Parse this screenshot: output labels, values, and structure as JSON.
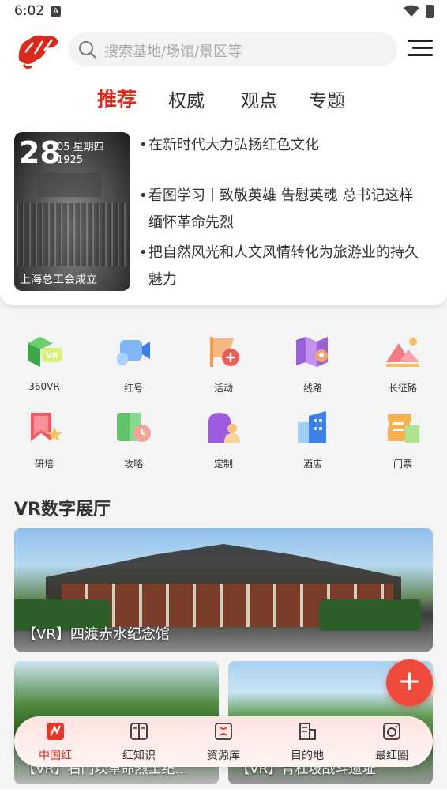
{
  "status_bar": {
    "time": "6:02",
    "notif": "A"
  },
  "header": {
    "search_placeholder": "搜索基地/场馆/景区等"
  },
  "tabs": [
    {
      "label": "推荐",
      "active": true
    },
    {
      "label": "权威",
      "active": false
    },
    {
      "label": "观点",
      "active": false
    },
    {
      "label": "专题",
      "active": false
    }
  ],
  "today_card": {
    "day": "28",
    "month_weekday": "05 星期四",
    "year": "1925",
    "caption": "上海总工会成立"
  },
  "news": [
    {
      "line1": "在新时代大力弘扬红色文化",
      "line2": ""
    },
    {
      "line1": "看图学习丨致敬英雄 告慰英魂 总书记这样",
      "line2": "缅怀革命先烈"
    },
    {
      "line1": "把自然风光和人文风情转化为旅游业的持久",
      "line2": "魅力"
    }
  ],
  "grid": [
    {
      "label": "360VR",
      "icon": "vr-icon"
    },
    {
      "label": "红号",
      "icon": "video-icon"
    },
    {
      "label": "活动",
      "icon": "flag-plus-icon"
    },
    {
      "label": "线路",
      "icon": "map-route-icon"
    },
    {
      "label": "长征路",
      "icon": "mountain-icon"
    },
    {
      "label": "研培",
      "icon": "bookmark-star-icon"
    },
    {
      "label": "攻略",
      "icon": "book-clock-icon"
    },
    {
      "label": "定制",
      "icon": "custom-user-icon"
    },
    {
      "label": "酒店",
      "icon": "hotel-icon"
    },
    {
      "label": "门票",
      "icon": "ticket-icon"
    }
  ],
  "section": {
    "title": "VR数字展厅"
  },
  "vr_items": [
    {
      "title": "【VR】四渡赤水纪念馆"
    },
    {
      "title": "【VR】石门坎革命烈士纪..."
    },
    {
      "title": "【VR】青杠坡战斗遗址"
    }
  ],
  "bottom_nav": [
    {
      "label": "中国红",
      "active": true
    },
    {
      "label": "红知识",
      "active": false
    },
    {
      "label": "资源库",
      "active": false
    },
    {
      "label": "目的地",
      "active": false
    },
    {
      "label": "最红圈",
      "active": false
    }
  ],
  "colors": {
    "accent": "#d92a1c",
    "fab": "#f04a3c"
  }
}
